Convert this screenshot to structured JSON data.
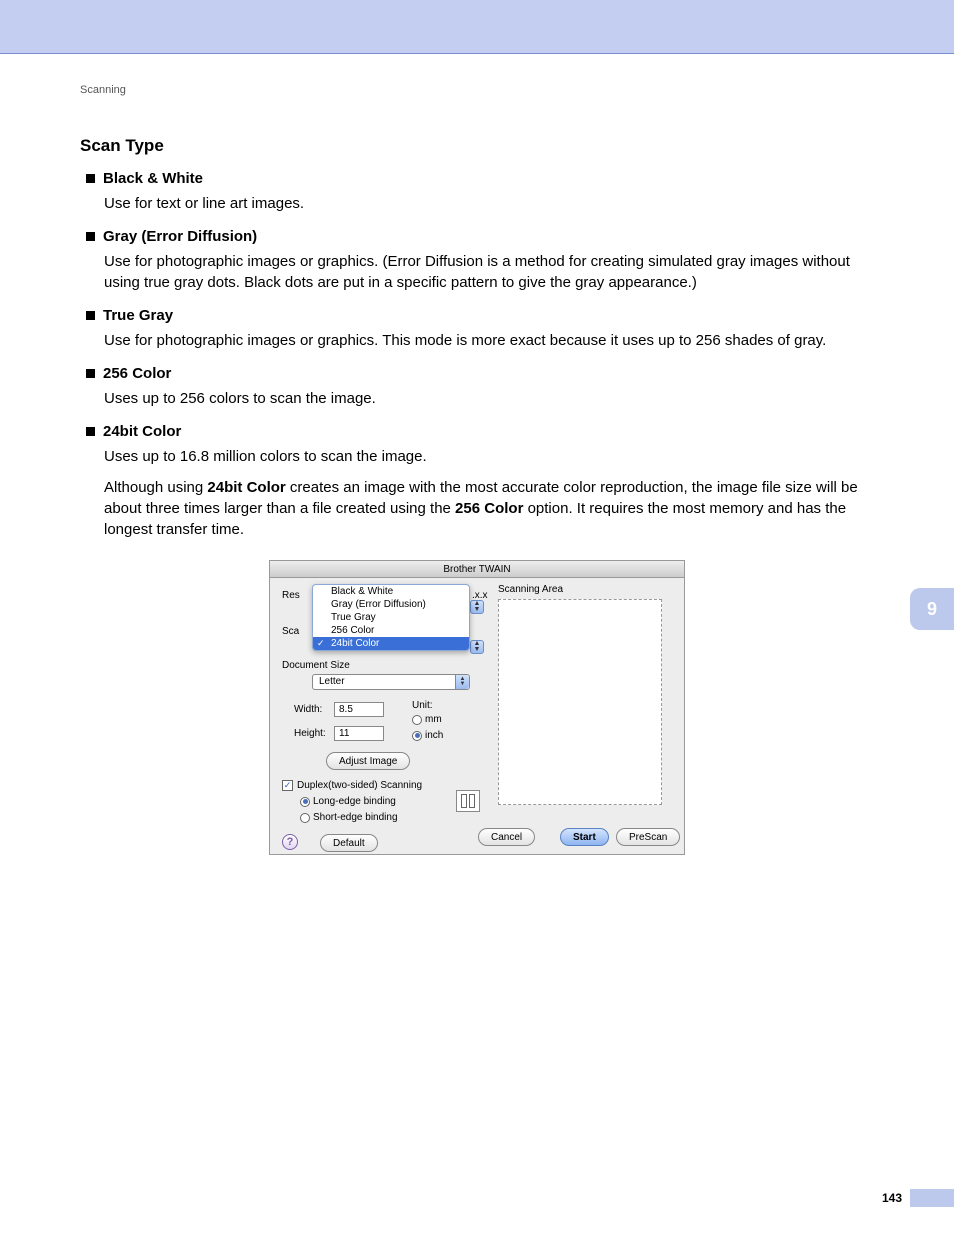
{
  "breadcrumb": "Scanning",
  "section_title": "Scan Type",
  "items": [
    {
      "heading": "Black & White",
      "body": "Use for text or line art images."
    },
    {
      "heading": "Gray (Error Diffusion)",
      "body": "Use for photographic images or graphics. (Error Diffusion is a method for creating simulated gray images without using true gray dots. Black dots are put in a specific pattern to give the gray appearance.)"
    },
    {
      "heading": "True Gray",
      "body": "Use for photographic images or graphics. This mode is more exact because it uses up to 256 shades of gray."
    },
    {
      "heading": "256 Color",
      "body": "Uses up to 256 colors to scan the image."
    },
    {
      "heading": "24bit Color",
      "body": "Uses up to 16.8 million colors to scan the image."
    }
  ],
  "note_parts": {
    "p1": "Although using ",
    "b1": "24bit Color",
    "p2": " creates an image with the most accurate color reproduction, the image file size will be about three times larger than a file created using the ",
    "b2": "256 Color",
    "p3": " option. It requires the most memory and has the longest transfer time."
  },
  "side_tab": "9",
  "page_number": "143",
  "dialog": {
    "title": "Brother TWAIN",
    "res_label_abbrev": "Res",
    "sca_label_abbrev": "Sca",
    "version_frag": ".x.x",
    "scan_type_options": [
      "Black & White",
      "Gray (Error Diffusion)",
      "True Gray",
      "256 Color",
      "24bit Color"
    ],
    "scan_type_selected": "24bit Color",
    "document_size_label": "Document Size",
    "document_size_value": "Letter",
    "width_label": "Width:",
    "width_value": "8.5",
    "height_label": "Height:",
    "height_value": "11",
    "unit_label": "Unit:",
    "unit_mm": "mm",
    "unit_inch": "inch",
    "adjust_image": "Adjust Image",
    "duplex_label": "Duplex(two-sided) Scanning",
    "binding_long": "Long-edge binding",
    "binding_short": "Short-edge binding",
    "default_btn": "Default",
    "cancel_btn": "Cancel",
    "start_btn": "Start",
    "prescan_btn": "PreScan",
    "scanning_area_label": "Scanning Area"
  }
}
